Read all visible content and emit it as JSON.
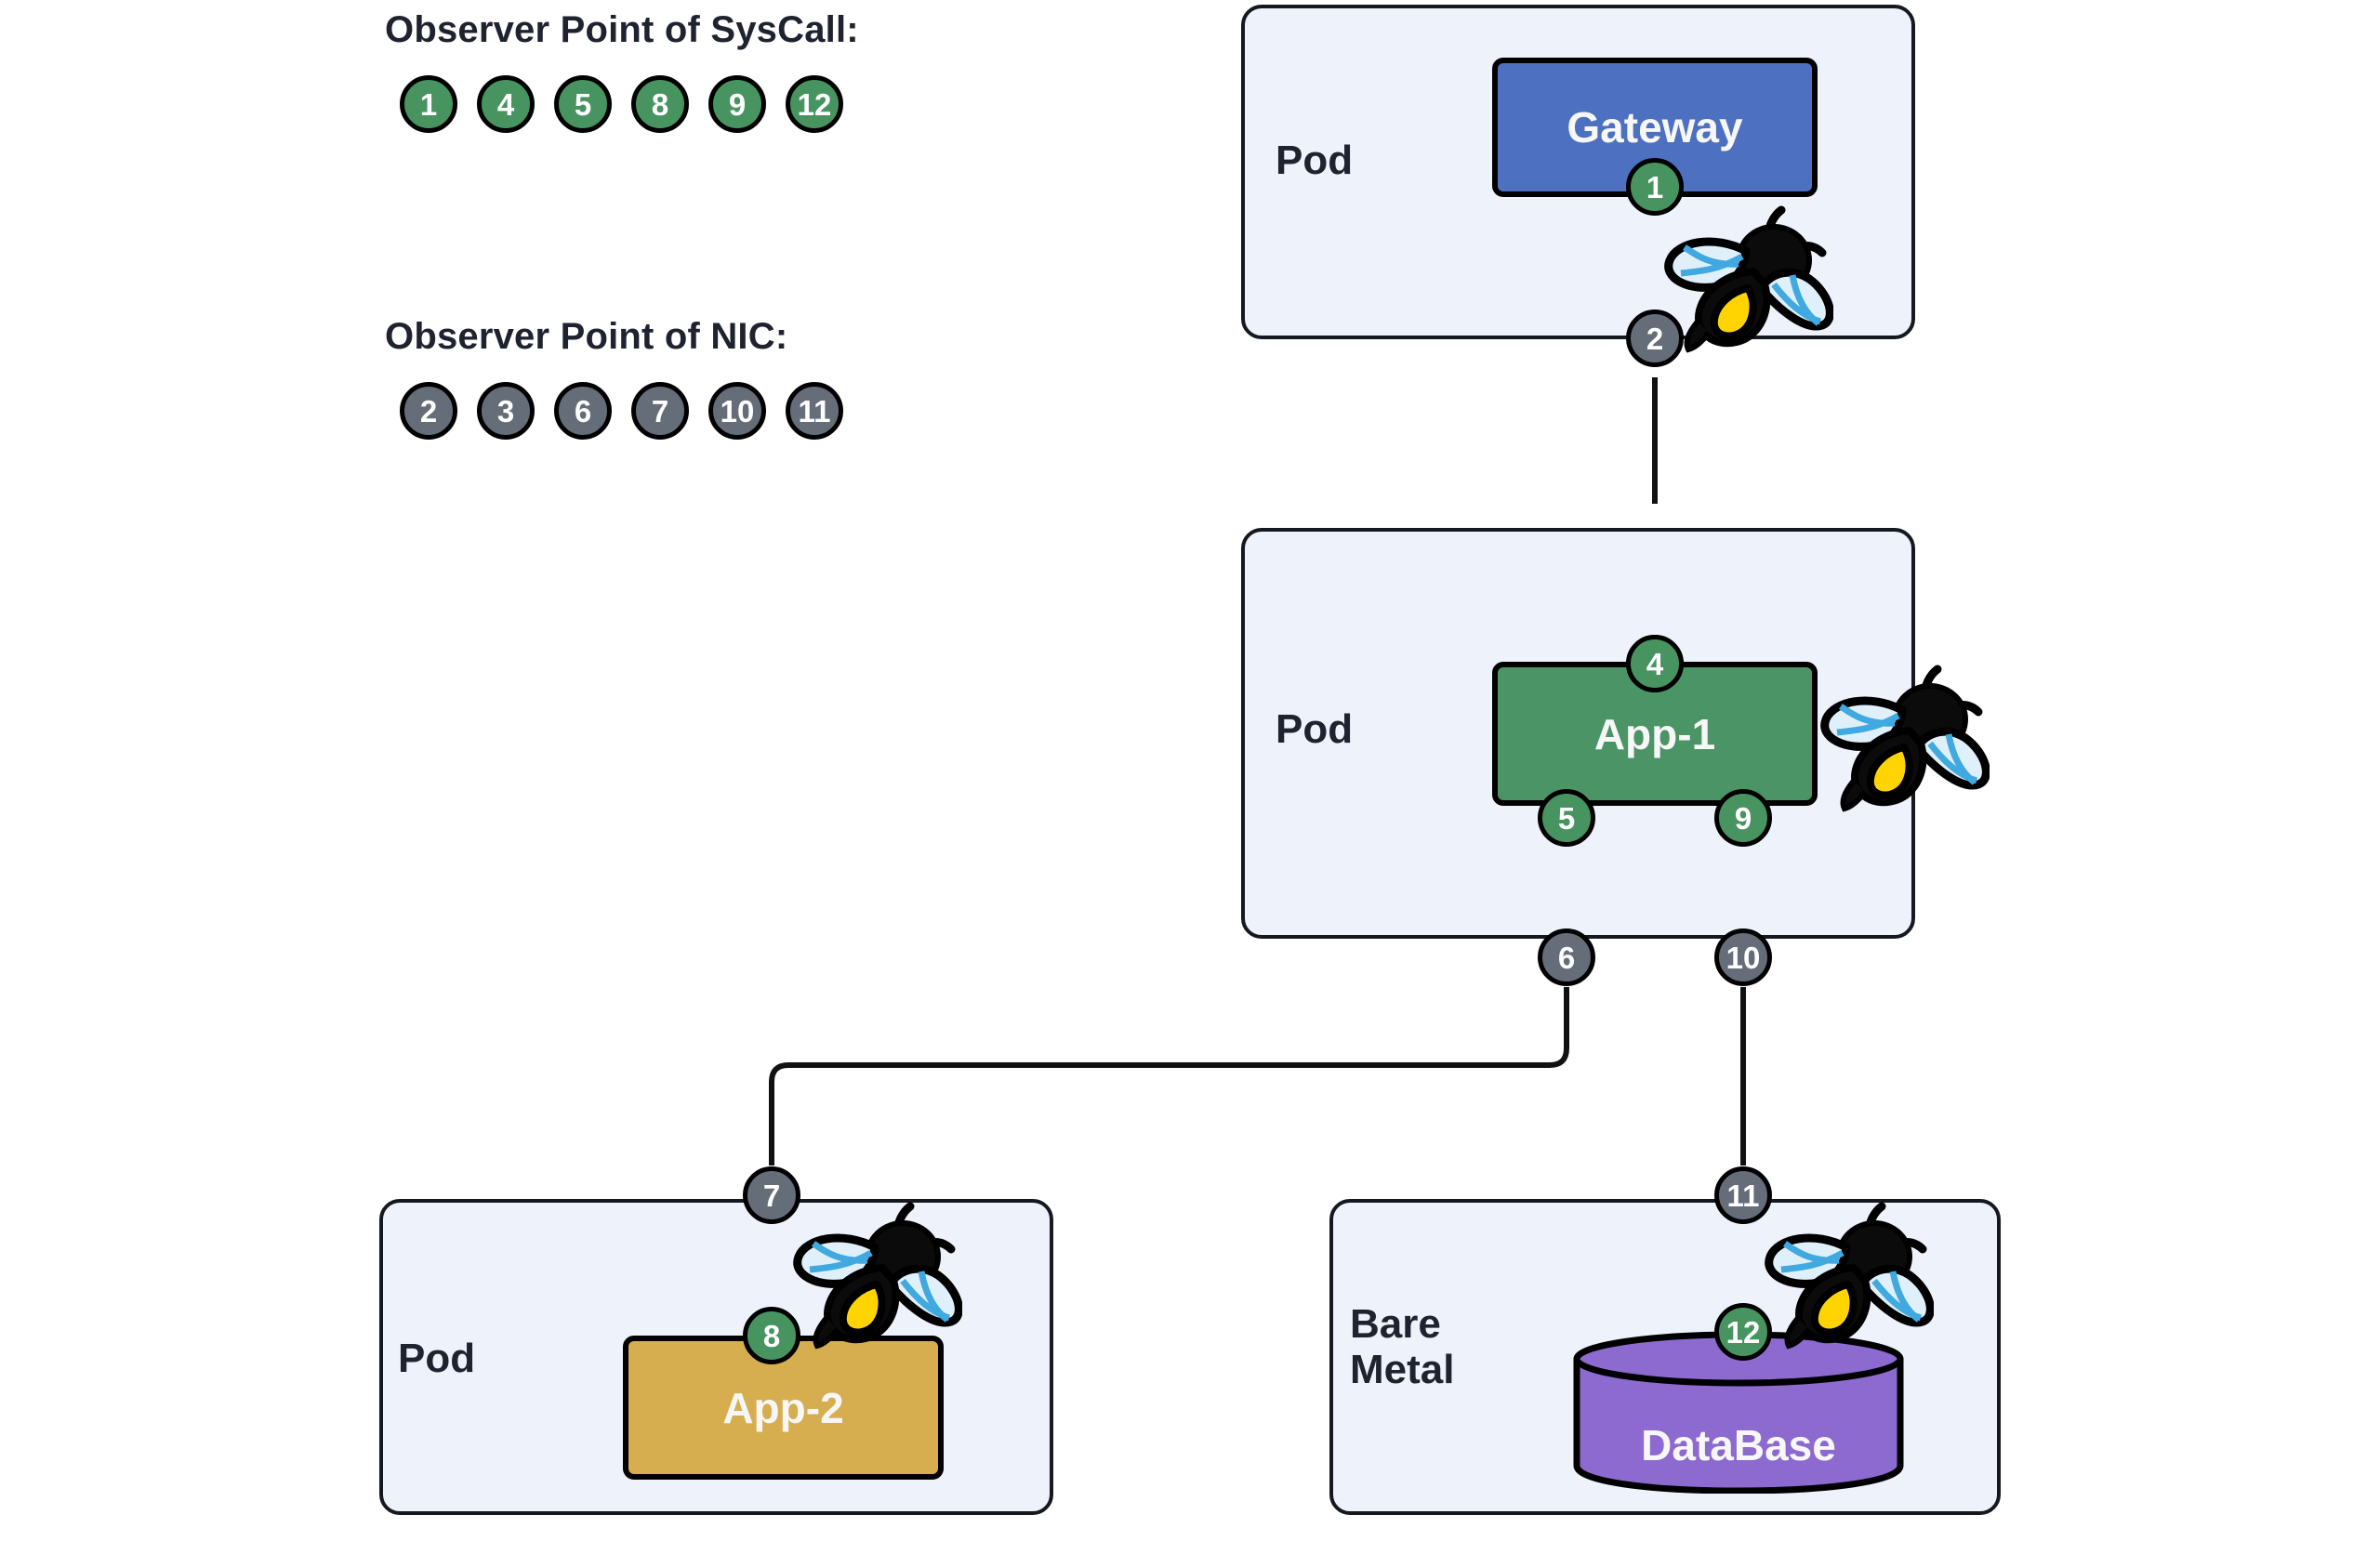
{
  "legend": {
    "syscall": {
      "title": "Observer Point of SysCall:",
      "color": "#479461",
      "badges": [
        "1",
        "4",
        "5",
        "8",
        "9",
        "12"
      ]
    },
    "nic": {
      "title": "Observer Point of NIC:",
      "color": "#656d78",
      "badges": [
        "2",
        "3",
        "6",
        "7",
        "10",
        "11"
      ]
    }
  },
  "containers": [
    {
      "id": "pod-gateway",
      "label": "Pod"
    },
    {
      "id": "pod-app1",
      "label": "Pod"
    },
    {
      "id": "pod-app2",
      "label": "Pod"
    },
    {
      "id": "host-database",
      "label": "Bare\nMetal"
    }
  ],
  "nodes": {
    "gateway": {
      "label": "Gateway",
      "color": "#4d71c0"
    },
    "app1": {
      "label": "App-1",
      "color": "#4a9465"
    },
    "app2": {
      "label": "App-2",
      "color": "#d6ae50"
    },
    "database": {
      "label": "DataBase",
      "color": "#8c6ad0"
    }
  },
  "observer_points": [
    {
      "id": "p1",
      "number": "1",
      "kind": "syscall",
      "attached_to": "gateway"
    },
    {
      "id": "p2",
      "number": "2",
      "kind": "nic",
      "attached_to": "pod-gateway"
    },
    {
      "id": "p3",
      "number": "3",
      "kind": "nic",
      "attached_to": "pod-app1"
    },
    {
      "id": "p4",
      "number": "4",
      "kind": "syscall",
      "attached_to": "app1"
    },
    {
      "id": "p5",
      "number": "5",
      "kind": "syscall",
      "attached_to": "app1"
    },
    {
      "id": "p6",
      "number": "6",
      "kind": "nic",
      "attached_to": "pod-app1"
    },
    {
      "id": "p7",
      "number": "7",
      "kind": "nic",
      "attached_to": "pod-app2"
    },
    {
      "id": "p8",
      "number": "8",
      "kind": "syscall",
      "attached_to": "app2"
    },
    {
      "id": "p9",
      "number": "9",
      "kind": "syscall",
      "attached_to": "app1"
    },
    {
      "id": "p10",
      "number": "10",
      "kind": "nic",
      "attached_to": "pod-app1"
    },
    {
      "id": "p11",
      "number": "11",
      "kind": "nic",
      "attached_to": "host-database"
    },
    {
      "id": "p12",
      "number": "12",
      "kind": "syscall",
      "attached_to": "database"
    }
  ],
  "icons": {
    "bee": "ebpf-bee-icon"
  },
  "palette": {
    "pod_fill": "#edf2fb",
    "pod_border": "#15181f",
    "outline": "#000000",
    "text_dark": "#1f2330",
    "text_light": "#f7f7f7"
  }
}
